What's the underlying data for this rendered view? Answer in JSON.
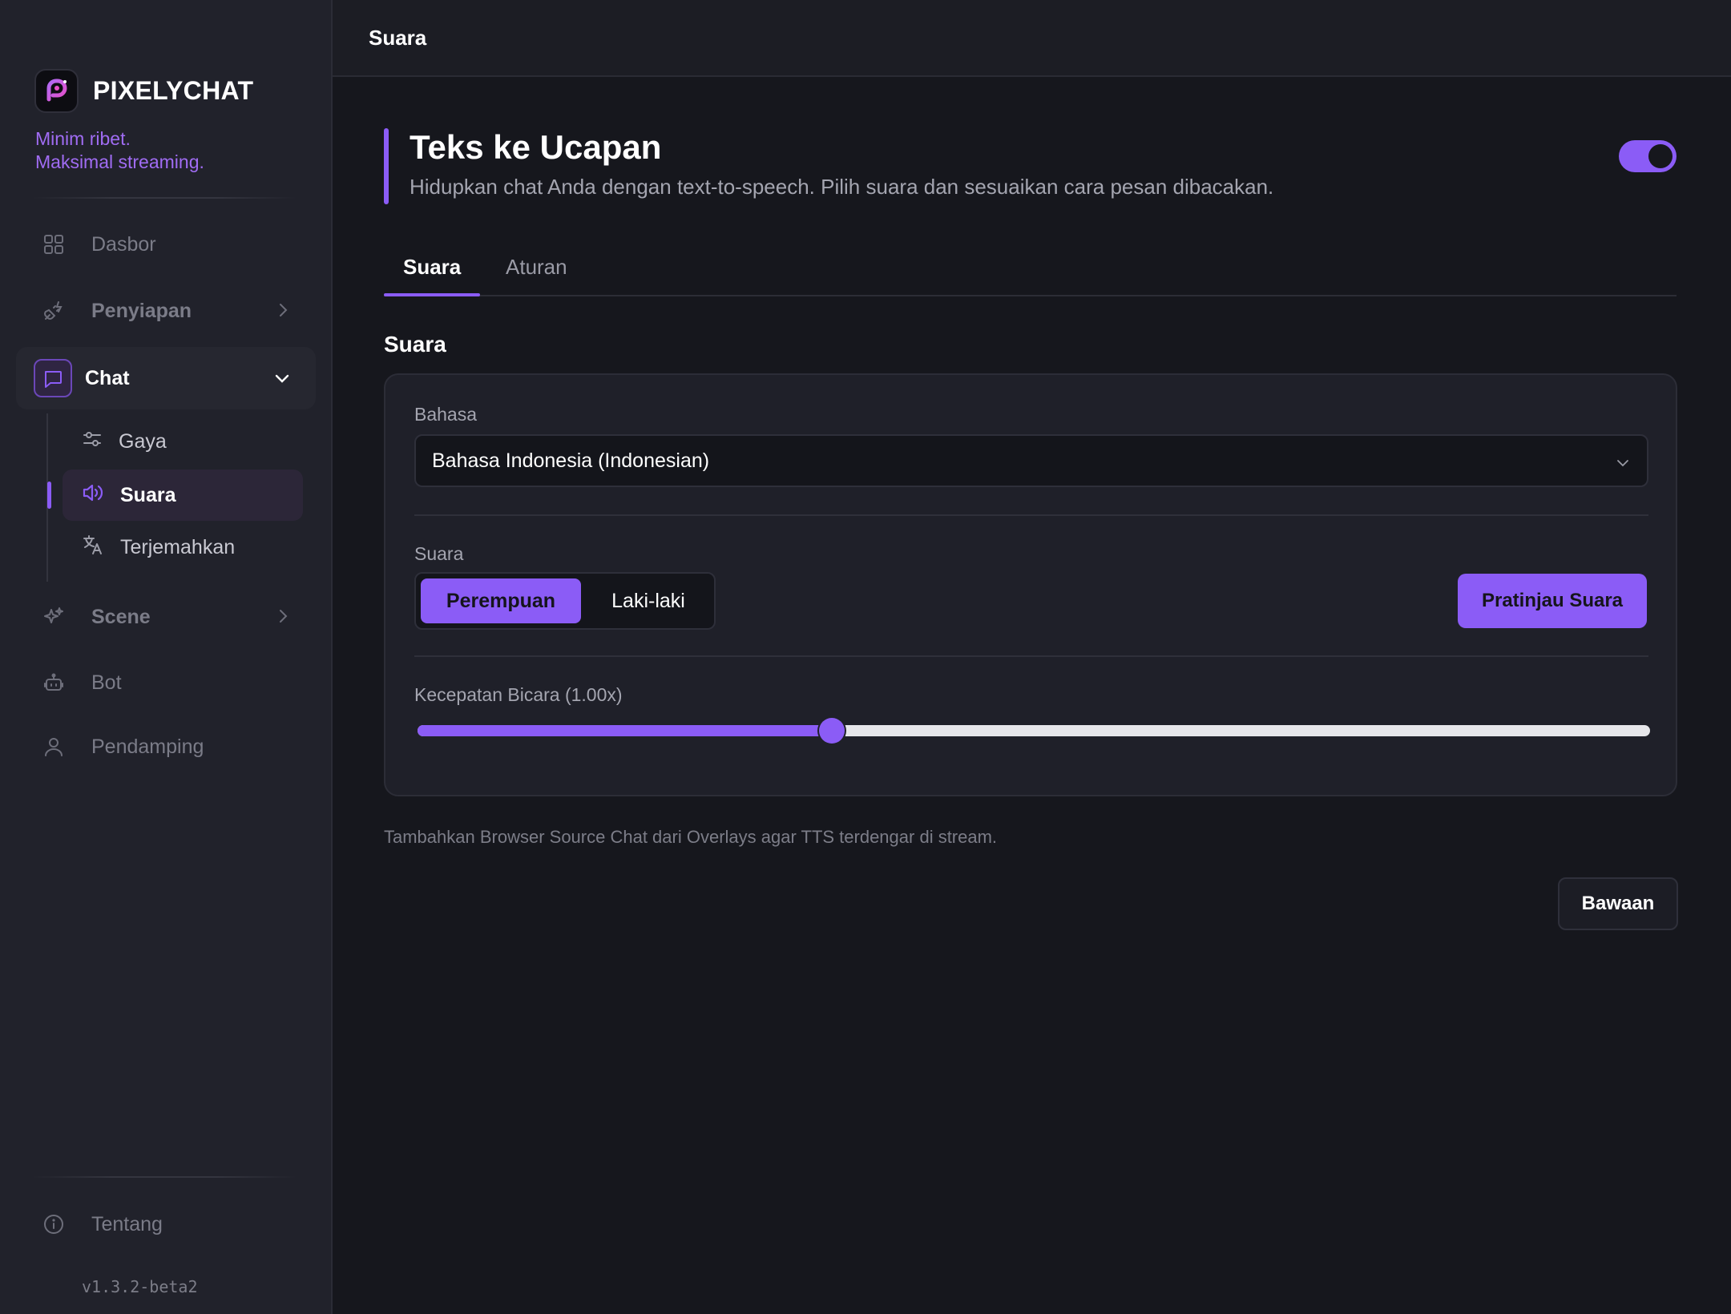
{
  "brand": {
    "name": "PIXELYCHAT",
    "tagline_line1": "Minim ribet.",
    "tagline_line2": "Maksimal streaming."
  },
  "sidebar": {
    "items": [
      {
        "label": "Dasbor",
        "icon": "grid-icon"
      },
      {
        "label": "Penyiapan",
        "icon": "plug-icon"
      },
      {
        "label": "Chat",
        "icon": "chat-bubble-icon",
        "expanded": true
      },
      {
        "label": "Scene",
        "icon": "sparkles-icon"
      },
      {
        "label": "Bot",
        "icon": "robot-icon"
      },
      {
        "label": "Pendamping",
        "icon": "user-icon"
      }
    ],
    "chat_subitems": [
      {
        "label": "Gaya",
        "icon": "sliders-icon"
      },
      {
        "label": "Suara",
        "icon": "speaker-icon",
        "active": true
      },
      {
        "label": "Terjemahkan",
        "icon": "translate-icon"
      }
    ],
    "footer": {
      "label": "Tentang",
      "icon": "info-icon",
      "version": "v1.3.2-beta2"
    }
  },
  "topbar": {
    "title": "Suara"
  },
  "section": {
    "title": "Teks ke Ucapan",
    "description": "Hidupkan chat Anda dengan text-to-speech. Pilih suara dan sesuaikan cara pesan dibacakan.",
    "enabled": true
  },
  "tabs": [
    {
      "label": "Suara",
      "active": true
    },
    {
      "label": "Aturan",
      "active": false
    }
  ],
  "voice_group": {
    "title": "Suara",
    "language_label": "Bahasa",
    "language_value": "Bahasa Indonesia (Indonesian)",
    "voice_label": "Suara",
    "voice_options": [
      "Perempuan",
      "Laki-laki"
    ],
    "voice_selected": "Perempuan",
    "preview_button": "Pratinjau Suara",
    "speed_label": "Kecepatan Bicara (1.00x)",
    "speed_fraction": 0.336
  },
  "hint": "Tambahkan Browser Source Chat dari Overlays agar TTS terdengar di stream.",
  "reset_button": "Bawaan",
  "colors": {
    "accent": "#8b5cf6",
    "brand_text": "#a06cf3",
    "sidebar_bg": "#21222b",
    "main_bg": "#16171d"
  }
}
